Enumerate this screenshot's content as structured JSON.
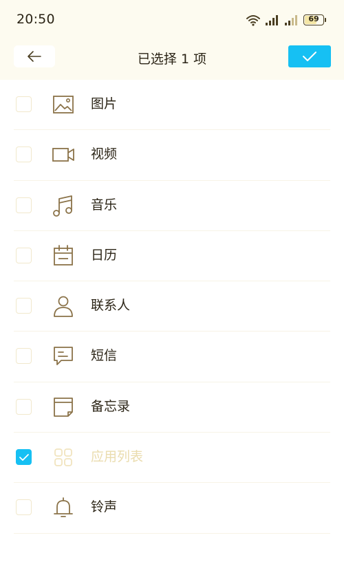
{
  "status_bar": {
    "time": "20:50",
    "battery_level": "69",
    "icons": [
      "wifi-icon",
      "signal-icon",
      "signal-icon",
      "battery-icon"
    ]
  },
  "toolbar": {
    "back_icon": "arrow-left-icon",
    "title": "已选择 1 项",
    "confirm_icon": "checkmark-icon"
  },
  "colors": {
    "accent": "#16c0f3",
    "background": "#fdfbf0",
    "icon": "#8a7248",
    "text": "#2b2416",
    "disabled_text": "#eadcae"
  },
  "items": [
    {
      "label": "图片",
      "icon": "image-icon",
      "checked": false
    },
    {
      "label": "视频",
      "icon": "video-icon",
      "checked": false
    },
    {
      "label": "音乐",
      "icon": "music-icon",
      "checked": false
    },
    {
      "label": "日历",
      "icon": "calendar-icon",
      "checked": false
    },
    {
      "label": "联系人",
      "icon": "contact-icon",
      "checked": false
    },
    {
      "label": "短信",
      "icon": "message-icon",
      "checked": false
    },
    {
      "label": "备忘录",
      "icon": "memo-icon",
      "checked": false
    },
    {
      "label": "应用列表",
      "icon": "app-list-icon",
      "checked": true
    },
    {
      "label": "铃声",
      "icon": "bell-icon",
      "checked": false
    }
  ]
}
